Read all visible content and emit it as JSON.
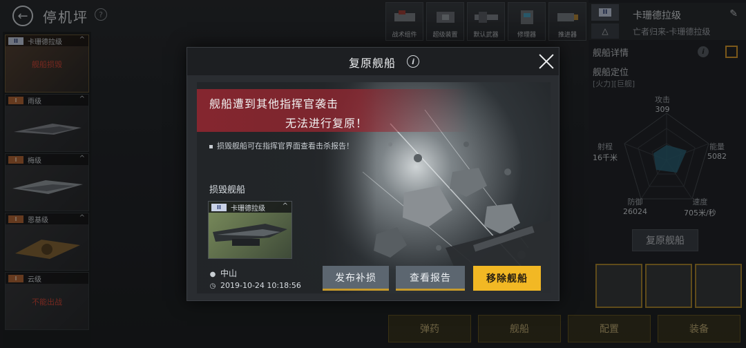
{
  "header": {
    "title": "停机坪"
  },
  "sidebar": {
    "cards": [
      {
        "name": "卡珊德拉级",
        "tier": "II",
        "status": "舰船损毁"
      },
      {
        "name": "雨级",
        "tier": "I",
        "status": ""
      },
      {
        "name": "梅级",
        "tier": "I",
        "status": ""
      },
      {
        "name": "恩基级",
        "tier": "I",
        "status": ""
      },
      {
        "name": "云级",
        "tier": "I",
        "status": "不能出战"
      }
    ]
  },
  "modules": [
    "战术组件",
    "超级装置",
    "默认武器",
    "修理器",
    "推进器"
  ],
  "right_panel": {
    "tier": "II",
    "ship_name": "卡珊德拉级",
    "ship_subtitle": "亡者归来-卡珊德拉级",
    "detail_title": "舰船详情",
    "position_label": "舰船定位",
    "tags": "[火力][巨舰]",
    "stats": {
      "attack_label": "攻击",
      "attack_value": "309",
      "range_label": "射程",
      "range_value": "16千米",
      "energy_label": "能量",
      "energy_value": "5082",
      "defense_label": "防御",
      "defense_value": "26024",
      "speed_label": "速度",
      "speed_value": "705米/秒"
    },
    "restore_button": "复原舰船"
  },
  "bottom_bar": {
    "buttons": [
      "弹药",
      "舰船",
      "配置",
      "装备"
    ]
  },
  "modal": {
    "title": "复原舰船",
    "alert_line1": "舰船遭到其他指挥官袭击",
    "alert_line2": "无法进行复原！",
    "note": "损毁舰船可在指挥官界面查看击杀报告！",
    "wrecked_label": "损毁舰船",
    "ship_tier": "II",
    "ship_name": "卡珊德拉级",
    "location": "中山",
    "datetime": "2019-10-24 10:18:56",
    "buttons": {
      "publish": "发布补损",
      "report": "查看报告",
      "remove": "移除舰船"
    }
  },
  "colors": {
    "accent_yellow": "#f2b824",
    "alert_red": "#962630",
    "tier_badge": "#c9d2e6"
  }
}
